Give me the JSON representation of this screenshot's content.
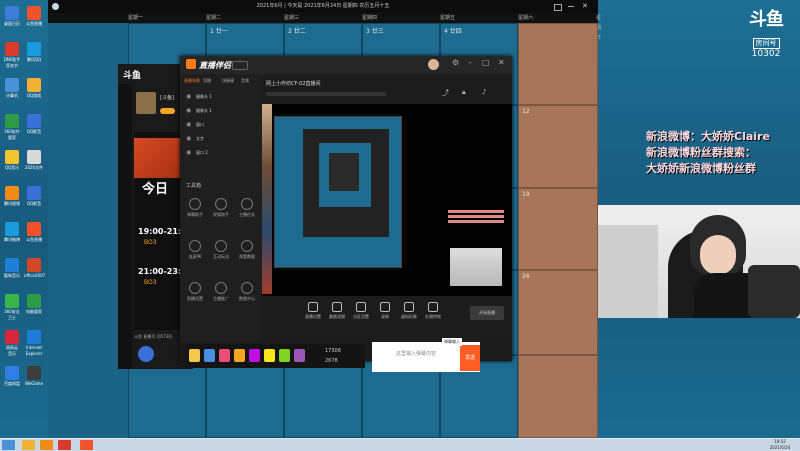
{
  "desktop": {
    "icons": [
      {
        "label": "桌面日历",
        "color": "#3b7dd8"
      },
      {
        "label": "DNF助手\n狂欢节",
        "color": "#d93a2b"
      },
      {
        "label": "计算机",
        "color": "#4a90d9"
      },
      {
        "label": "360软件\n管家",
        "color": "#2e9b46"
      },
      {
        "label": "QQ音乐",
        "color": "#f4c430"
      },
      {
        "label": "腾讯视频",
        "color": "#f28a1a"
      },
      {
        "label": "腾讯微博",
        "color": "#1a9be0"
      },
      {
        "label": "酷狗音乐",
        "color": "#1e7fd6"
      },
      {
        "label": "360安全\n卫士",
        "color": "#39b54a"
      },
      {
        "label": "网易云\n音乐",
        "color": "#d7263d"
      },
      {
        "label": "百度网盘",
        "color": "#2f7ee6"
      },
      {
        "label": "斗鱼直播",
        "color": "#f0522b"
      },
      {
        "label": "腾讯QQ",
        "color": "#1a9be0"
      },
      {
        "label": "QQ游戏",
        "color": "#f2b134"
      },
      {
        "label": "QQ影音",
        "color": "#3a6fd8"
      },
      {
        "label": "2020文件",
        "color": "#d9d9d9"
      },
      {
        "label": "QQ影音",
        "color": "#3a6fd8"
      },
      {
        "label": "斗鱼直播",
        "color": "#f0522b"
      },
      {
        "label": "office2007",
        "color": "#d24726"
      },
      {
        "label": "电脑管家",
        "color": "#2e9b46"
      },
      {
        "label": "Internet\nExplorer",
        "color": "#1f7bd6"
      },
      {
        "label": "WeGame",
        "color": "#3d3d3d"
      }
    ]
  },
  "calendar": {
    "title": "2021年6月 | 今天是 2021年6月24日 星期四 农历五月十五",
    "weekdays": [
      "星期一",
      "星期二",
      "星期三",
      "星期四",
      "星期五",
      "星期六",
      "星期日"
    ],
    "day_cells": [
      {
        "label": "1 廿一"
      },
      {
        "label": "2 廿二"
      },
      {
        "label": "3 廿三"
      },
      {
        "label": "4 廿四"
      },
      {
        "label": "12"
      },
      {
        "label": "19"
      },
      {
        "label": "20"
      },
      {
        "label": "26"
      },
      {
        "label": "27 廿一"
      }
    ]
  },
  "brand": {
    "logo_text": "斗鱼",
    "room_label": "房间号",
    "room_number": "10302"
  },
  "danmaku": {
    "line1": "新浪微博：大娇娇Claire",
    "line2": "新浪微博粉丝群搜索：",
    "line3": "大娇娇新浪微博粉丝群"
  },
  "douyu_app": {
    "logo": "斗鱼",
    "badge": "[斗鱼]",
    "banner_today": "今日",
    "schedule": [
      {
        "time": "19:00-21:00",
        "detail": "BO3"
      },
      {
        "time": "21:00-23:00",
        "detail": "BO3"
      }
    ],
    "footer": "斗鱼 直播号 (05730)"
  },
  "companion": {
    "logo": "直播伴侣",
    "title": "网上小作坊CF-02直播间",
    "tabs": [
      "直播场景",
      "导播",
      "快捷键",
      "音频"
    ],
    "scene_items": [
      "摄像头 1",
      "摄像头 1",
      "窗口",
      "文字",
      "窗口 2"
    ],
    "tools_title": "工具箱",
    "tools": [
      "弹幕助手",
      "视频助手",
      "主播任务",
      "连麦PK",
      "互动玩法",
      "观看数据",
      "直播设置",
      "主播推广",
      "数据中心"
    ],
    "toolbar": [
      "直播设置",
      "美颜滤镜",
      "分区设置",
      "录制",
      "虚拟形象",
      "礼物特效"
    ],
    "bottom_tip": "欢迎来到斗鱼直播伴侣，开播请点击开始直播",
    "stats_viewers": "17306",
    "stats_rank": "2678",
    "start_button": "开始直播"
  },
  "chat": {
    "placeholder": "这里输入弹幕内容",
    "send": "发送",
    "hint": "弹幕输入"
  },
  "taskbar": {
    "time": "19:52",
    "date": "2021/6/24"
  }
}
